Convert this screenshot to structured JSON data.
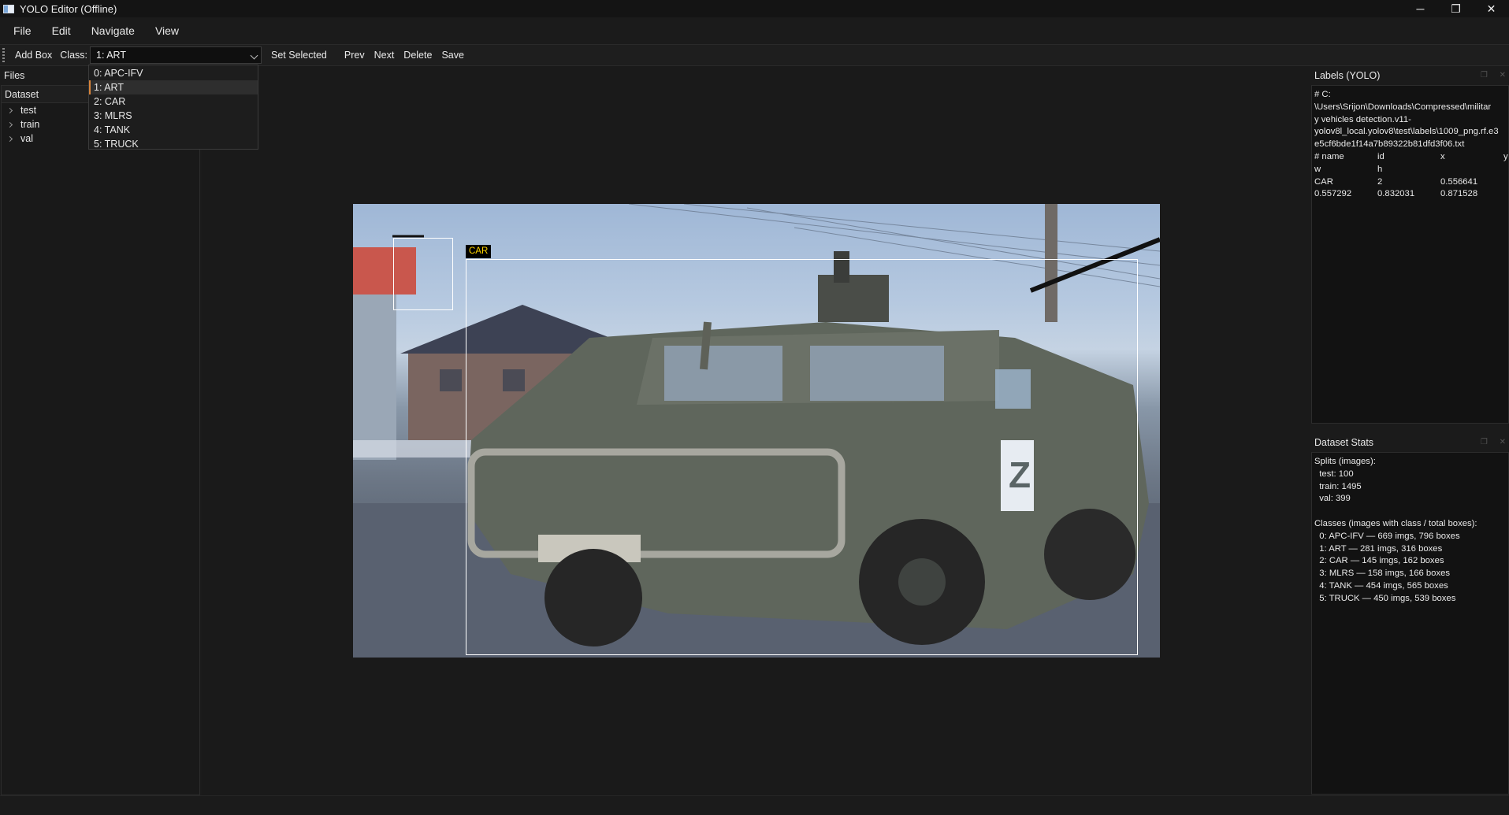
{
  "window": {
    "title": "YOLO Editor (Offline)",
    "controls": {
      "minimize": "─",
      "restore": "❐",
      "close": "✕"
    }
  },
  "menu": {
    "items": [
      "File",
      "Edit",
      "Navigate",
      "View"
    ]
  },
  "toolbar": {
    "add_box": "Add Box",
    "class_label": "Class:",
    "class_selected": "1: ART",
    "set_selected": "Set Selected",
    "prev": "Prev",
    "next": "Next",
    "delete": "Delete",
    "save": "Save"
  },
  "class_dropdown": {
    "options": [
      "0: APC-IFV",
      "1: ART",
      "2: CAR",
      "3: MLRS",
      "4: TANK",
      "5: TRUCK"
    ],
    "selected_index": 1
  },
  "files_panel": {
    "title": "Files",
    "header": "Dataset",
    "items": [
      "test",
      "train",
      "val"
    ]
  },
  "canvas": {
    "box_label": "CAR"
  },
  "labels_panel": {
    "title": "Labels (YOLO)",
    "path_lines": [
      "# C:",
      "\\Users\\Srijon\\Downloads\\Compressed\\militar",
      "y vehicles detection.v11-",
      "yolov8l_local.yolov8\\test\\labels\\1009_png.rf.e3",
      "e5cf6bde1f14a7b89322b81dfd3f06.txt"
    ],
    "table_rows": [
      [
        "# name",
        "id",
        "x",
        "y"
      ],
      [
        "w",
        "h",
        "",
        ""
      ],
      [
        "CAR",
        "2",
        "0.556641",
        ""
      ],
      [
        "0.557292",
        "0.832031",
        "0.871528",
        ""
      ]
    ]
  },
  "stats_panel": {
    "title": "Dataset Stats",
    "lines": [
      "Splits (images):",
      "  test: 100",
      "  train: 1495",
      "  val: 399",
      "",
      "Classes (images with class / total boxes):",
      "  0: APC-IFV — 669 imgs, 796 boxes",
      "  1: ART — 281 imgs, 316 boxes",
      "  2: CAR — 145 imgs, 162 boxes",
      "  3: MLRS — 158 imgs, 166 boxes",
      "  4: TANK — 454 imgs, 565 boxes",
      "  5: TRUCK — 450 imgs, 539 boxes"
    ]
  },
  "dock_icons": {
    "float": "❐",
    "close": "✕"
  }
}
